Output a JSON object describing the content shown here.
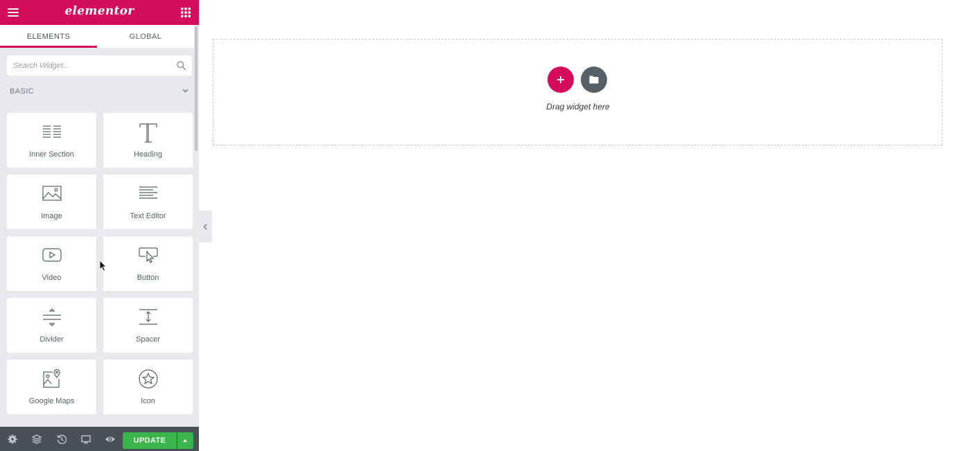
{
  "header": {
    "logo_text": "elementor",
    "brand_color": "#d30c5c",
    "menu_icon": "hamburger-icon",
    "apps_icon": "grid-icon"
  },
  "tabs": [
    {
      "label": "ELEMENTS",
      "active": true
    },
    {
      "label": "GLOBAL",
      "active": false
    }
  ],
  "search": {
    "placeholder": "Search Widget...",
    "value": "",
    "icon": "search-icon"
  },
  "category": {
    "label": "BASIC",
    "icon": "chevron-down-icon"
  },
  "widgets": [
    {
      "label": "Inner Section",
      "icon": "inner-section-icon"
    },
    {
      "label": "Heading",
      "icon": "heading-icon"
    },
    {
      "label": "Image",
      "icon": "image-icon"
    },
    {
      "label": "Text Editor",
      "icon": "text-editor-icon"
    },
    {
      "label": "Video",
      "icon": "video-icon"
    },
    {
      "label": "Button",
      "icon": "button-icon"
    },
    {
      "label": "Divider",
      "icon": "divider-icon"
    },
    {
      "label": "Spacer",
      "icon": "spacer-icon"
    },
    {
      "label": "Google Maps",
      "icon": "google-maps-icon"
    },
    {
      "label": "Icon",
      "icon": "star-icon"
    }
  ],
  "footer": {
    "tools": [
      "settings-icon",
      "navigator-icon",
      "history-icon",
      "responsive-icon",
      "preview-icon"
    ],
    "update_label": "UPDATE",
    "update_color": "#39b54a"
  },
  "canvas": {
    "drag_hint": "Drag widget here",
    "add_section_icon": "plus-icon",
    "add_template_icon": "folder-icon"
  }
}
